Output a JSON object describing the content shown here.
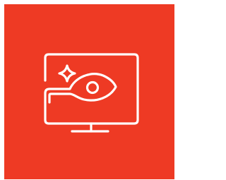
{
  "tile": {
    "background_color": "#ee3a24",
    "icon": "monitor-eye-sparkle-icon",
    "stroke_color": "#ffffff"
  }
}
